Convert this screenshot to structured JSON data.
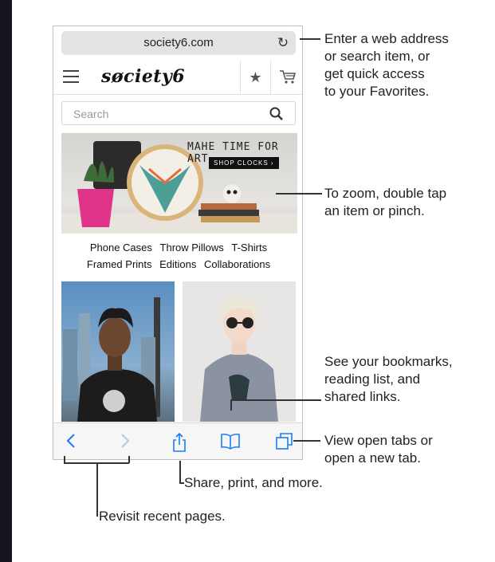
{
  "browser": {
    "url": "society6.com",
    "site_logo": "søciety6",
    "search_placeholder": "Search"
  },
  "hero": {
    "tagline": "MAHE TIME FOR ART",
    "cta": "SHOP CLOCKS ›"
  },
  "categories": [
    "Phone Cases",
    "Throw Pillows",
    "T-Shirts",
    "Framed Prints",
    "Editions",
    "Collaborations"
  ],
  "callouts": {
    "address": [
      "Enter a web address",
      "or search item, or",
      "get quick access",
      "to your Favorites."
    ],
    "zoom": [
      "To zoom, double tap",
      "an item or pinch."
    ],
    "bookmarks": [
      "See your bookmarks,",
      "reading list, and",
      "shared links."
    ],
    "tabs": [
      "View open tabs or",
      "open a new tab."
    ],
    "share": "Share, print, and more.",
    "history": "Revisit recent pages."
  },
  "colors": {
    "toolbar_icon": "#1a7cf5",
    "toolbar_icon_disabled": "#b8c8dc",
    "backdrop": "#1e1e2c"
  },
  "icons": [
    "menu-icon",
    "star-icon",
    "cart-icon",
    "search-icon",
    "reload-icon",
    "back-icon",
    "forward-icon",
    "share-icon",
    "bookmarks-icon",
    "tabs-icon"
  ]
}
